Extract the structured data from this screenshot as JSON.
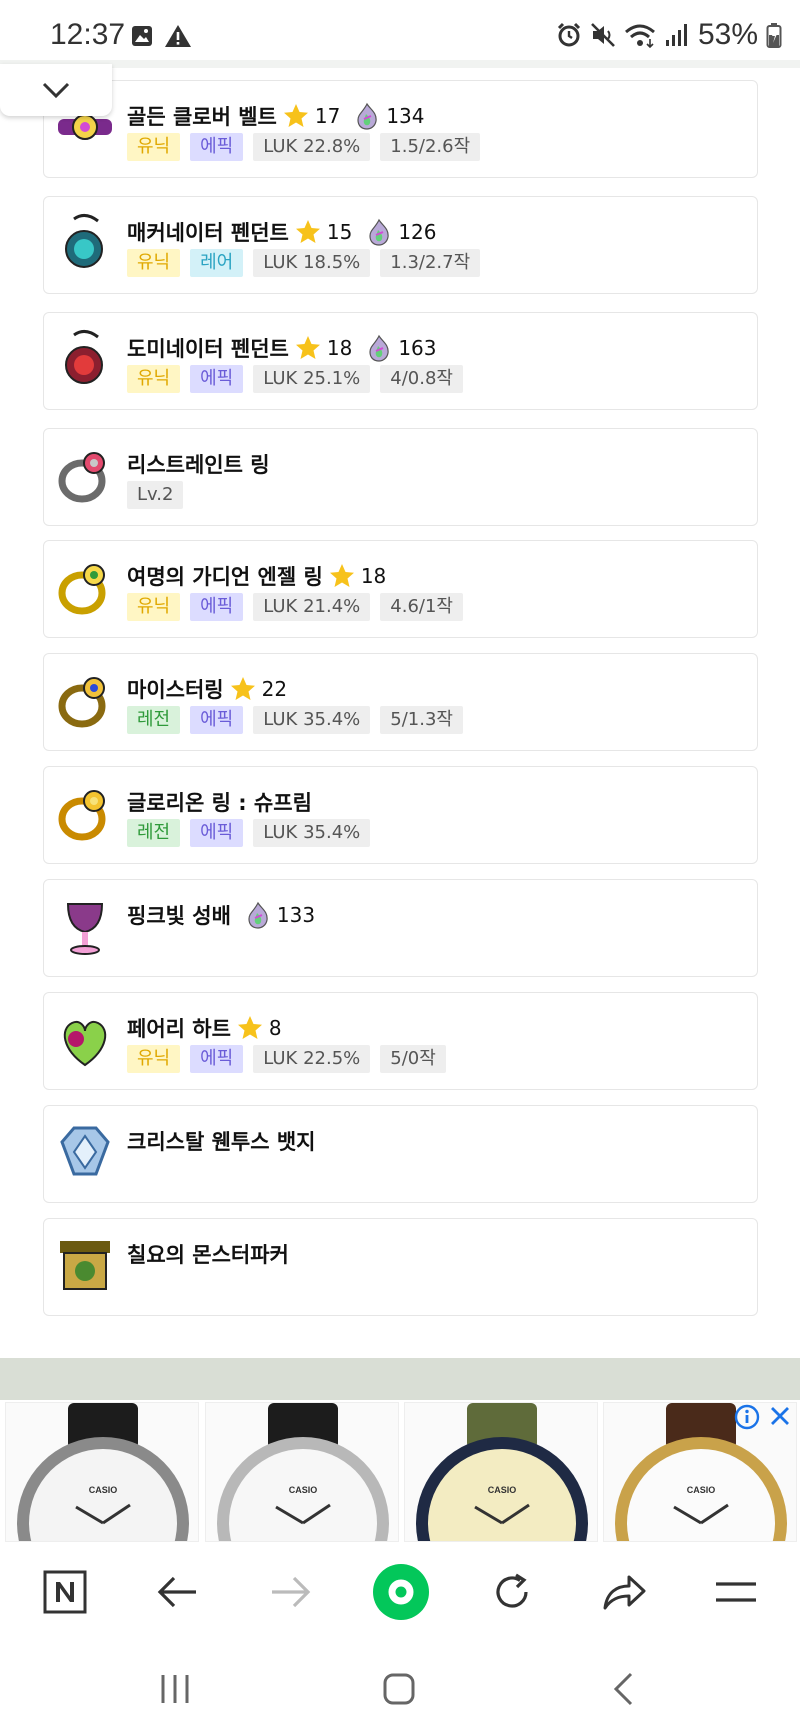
{
  "status_bar": {
    "time": "12:37",
    "left_icons": [
      "image-icon",
      "warning-icon"
    ],
    "right_icons": [
      "alarm-icon",
      "mute-icon",
      "wifi-icon",
      "signal-icon",
      "battery-icon"
    ],
    "battery": "53%"
  },
  "collapse_button": {
    "icon": "chevron-down-icon"
  },
  "items": [
    {
      "name": "골든 클로버 벨트",
      "star": "17",
      "flame": "134",
      "tags": [
        {
          "text": "유닉",
          "type": "unique"
        },
        {
          "text": "에픽",
          "type": "epic"
        },
        {
          "text": "LUK 22.8%",
          "type": "stat"
        },
        {
          "text": "1.5/2.6작",
          "type": "stat"
        }
      ]
    },
    {
      "name": "매커네이터 펜던트",
      "star": "15",
      "flame": "126",
      "tags": [
        {
          "text": "유닉",
          "type": "unique"
        },
        {
          "text": "레어",
          "type": "rare"
        },
        {
          "text": "LUK 18.5%",
          "type": "stat"
        },
        {
          "text": "1.3/2.7작",
          "type": "stat"
        }
      ]
    },
    {
      "name": "도미네이터 펜던트",
      "star": "18",
      "flame": "163",
      "tags": [
        {
          "text": "유닉",
          "type": "unique"
        },
        {
          "text": "에픽",
          "type": "epic"
        },
        {
          "text": "LUK 25.1%",
          "type": "stat"
        },
        {
          "text": "4/0.8작",
          "type": "stat"
        }
      ]
    },
    {
      "name": "리스트레인트 링",
      "star": "",
      "flame": "",
      "tags": [
        {
          "text": "Lv.2",
          "type": "stat"
        }
      ]
    },
    {
      "name": "여명의 가디언 엔젤 링",
      "star": "18",
      "flame": "",
      "tags": [
        {
          "text": "유닉",
          "type": "unique"
        },
        {
          "text": "에픽",
          "type": "epic"
        },
        {
          "text": "LUK 21.4%",
          "type": "stat"
        },
        {
          "text": "4.6/1작",
          "type": "stat"
        }
      ]
    },
    {
      "name": "마이스터링",
      "star": "22",
      "flame": "",
      "tags": [
        {
          "text": "레전",
          "type": "legend"
        },
        {
          "text": "에픽",
          "type": "epic"
        },
        {
          "text": "LUK 35.4%",
          "type": "stat"
        },
        {
          "text": "5/1.3작",
          "type": "stat"
        }
      ]
    },
    {
      "name": "글로리온 링 : 슈프림",
      "star": "",
      "flame": "",
      "tags": [
        {
          "text": "레전",
          "type": "legend"
        },
        {
          "text": "에픽",
          "type": "epic"
        },
        {
          "text": "LUK 35.4%",
          "type": "stat"
        }
      ]
    },
    {
      "name": "핑크빛 성배",
      "star": "",
      "flame": "133",
      "tags": []
    },
    {
      "name": "페어리 하트",
      "star": "8",
      "flame": "",
      "tags": [
        {
          "text": "유닉",
          "type": "unique"
        },
        {
          "text": "에픽",
          "type": "epic"
        },
        {
          "text": "LUK 22.5%",
          "type": "stat"
        },
        {
          "text": "5/0작",
          "type": "stat"
        }
      ]
    },
    {
      "name": "크리스탈 웬투스 뱃지",
      "star": "",
      "flame": "",
      "tags": []
    },
    {
      "name": "칠요의 몬스터파커",
      "star": "",
      "flame": "",
      "tags": []
    }
  ],
  "item_icons": [
    "belt-icon",
    "pendant-icon",
    "pendant-icon",
    "ring-icon",
    "ring-icon",
    "ring-icon",
    "ring-icon",
    "chalice-icon",
    "heart-icon",
    "badge-icon",
    "monster-parker-icon"
  ],
  "colors": {
    "unique_bg": "#fff6c4",
    "unique_text": "#e0a800",
    "legend_bg": "#d9f2db",
    "legend_text": "#2f9a3a",
    "epic_bg": "#dcdcff",
    "epic_text": "#6a5cd8",
    "rare_bg": "#d3f1f8",
    "rare_text": "#2aa3c2",
    "stat_bg": "#eeeeee",
    "stat_text": "#555555",
    "star": "#f7c21b",
    "browser_accent": "#03c75a",
    "band": "#d9ded5"
  },
  "ad": {
    "brand": "CASIO",
    "tiles": [
      "watch-silver-black-strap",
      "watch-white-black-strap",
      "watch-cream-green-strap",
      "watch-gold-brown-strap"
    ],
    "info_icon": "info-icon",
    "close_icon": "close-icon"
  },
  "browser_toolbar": {
    "buttons": [
      "naver-n-icon",
      "back-arrow-icon",
      "forward-arrow-icon",
      "home-green-icon",
      "refresh-icon",
      "share-icon",
      "menu-icon"
    ]
  },
  "system_nav": {
    "buttons": [
      "recents-icon",
      "home-icon",
      "back-icon"
    ]
  }
}
